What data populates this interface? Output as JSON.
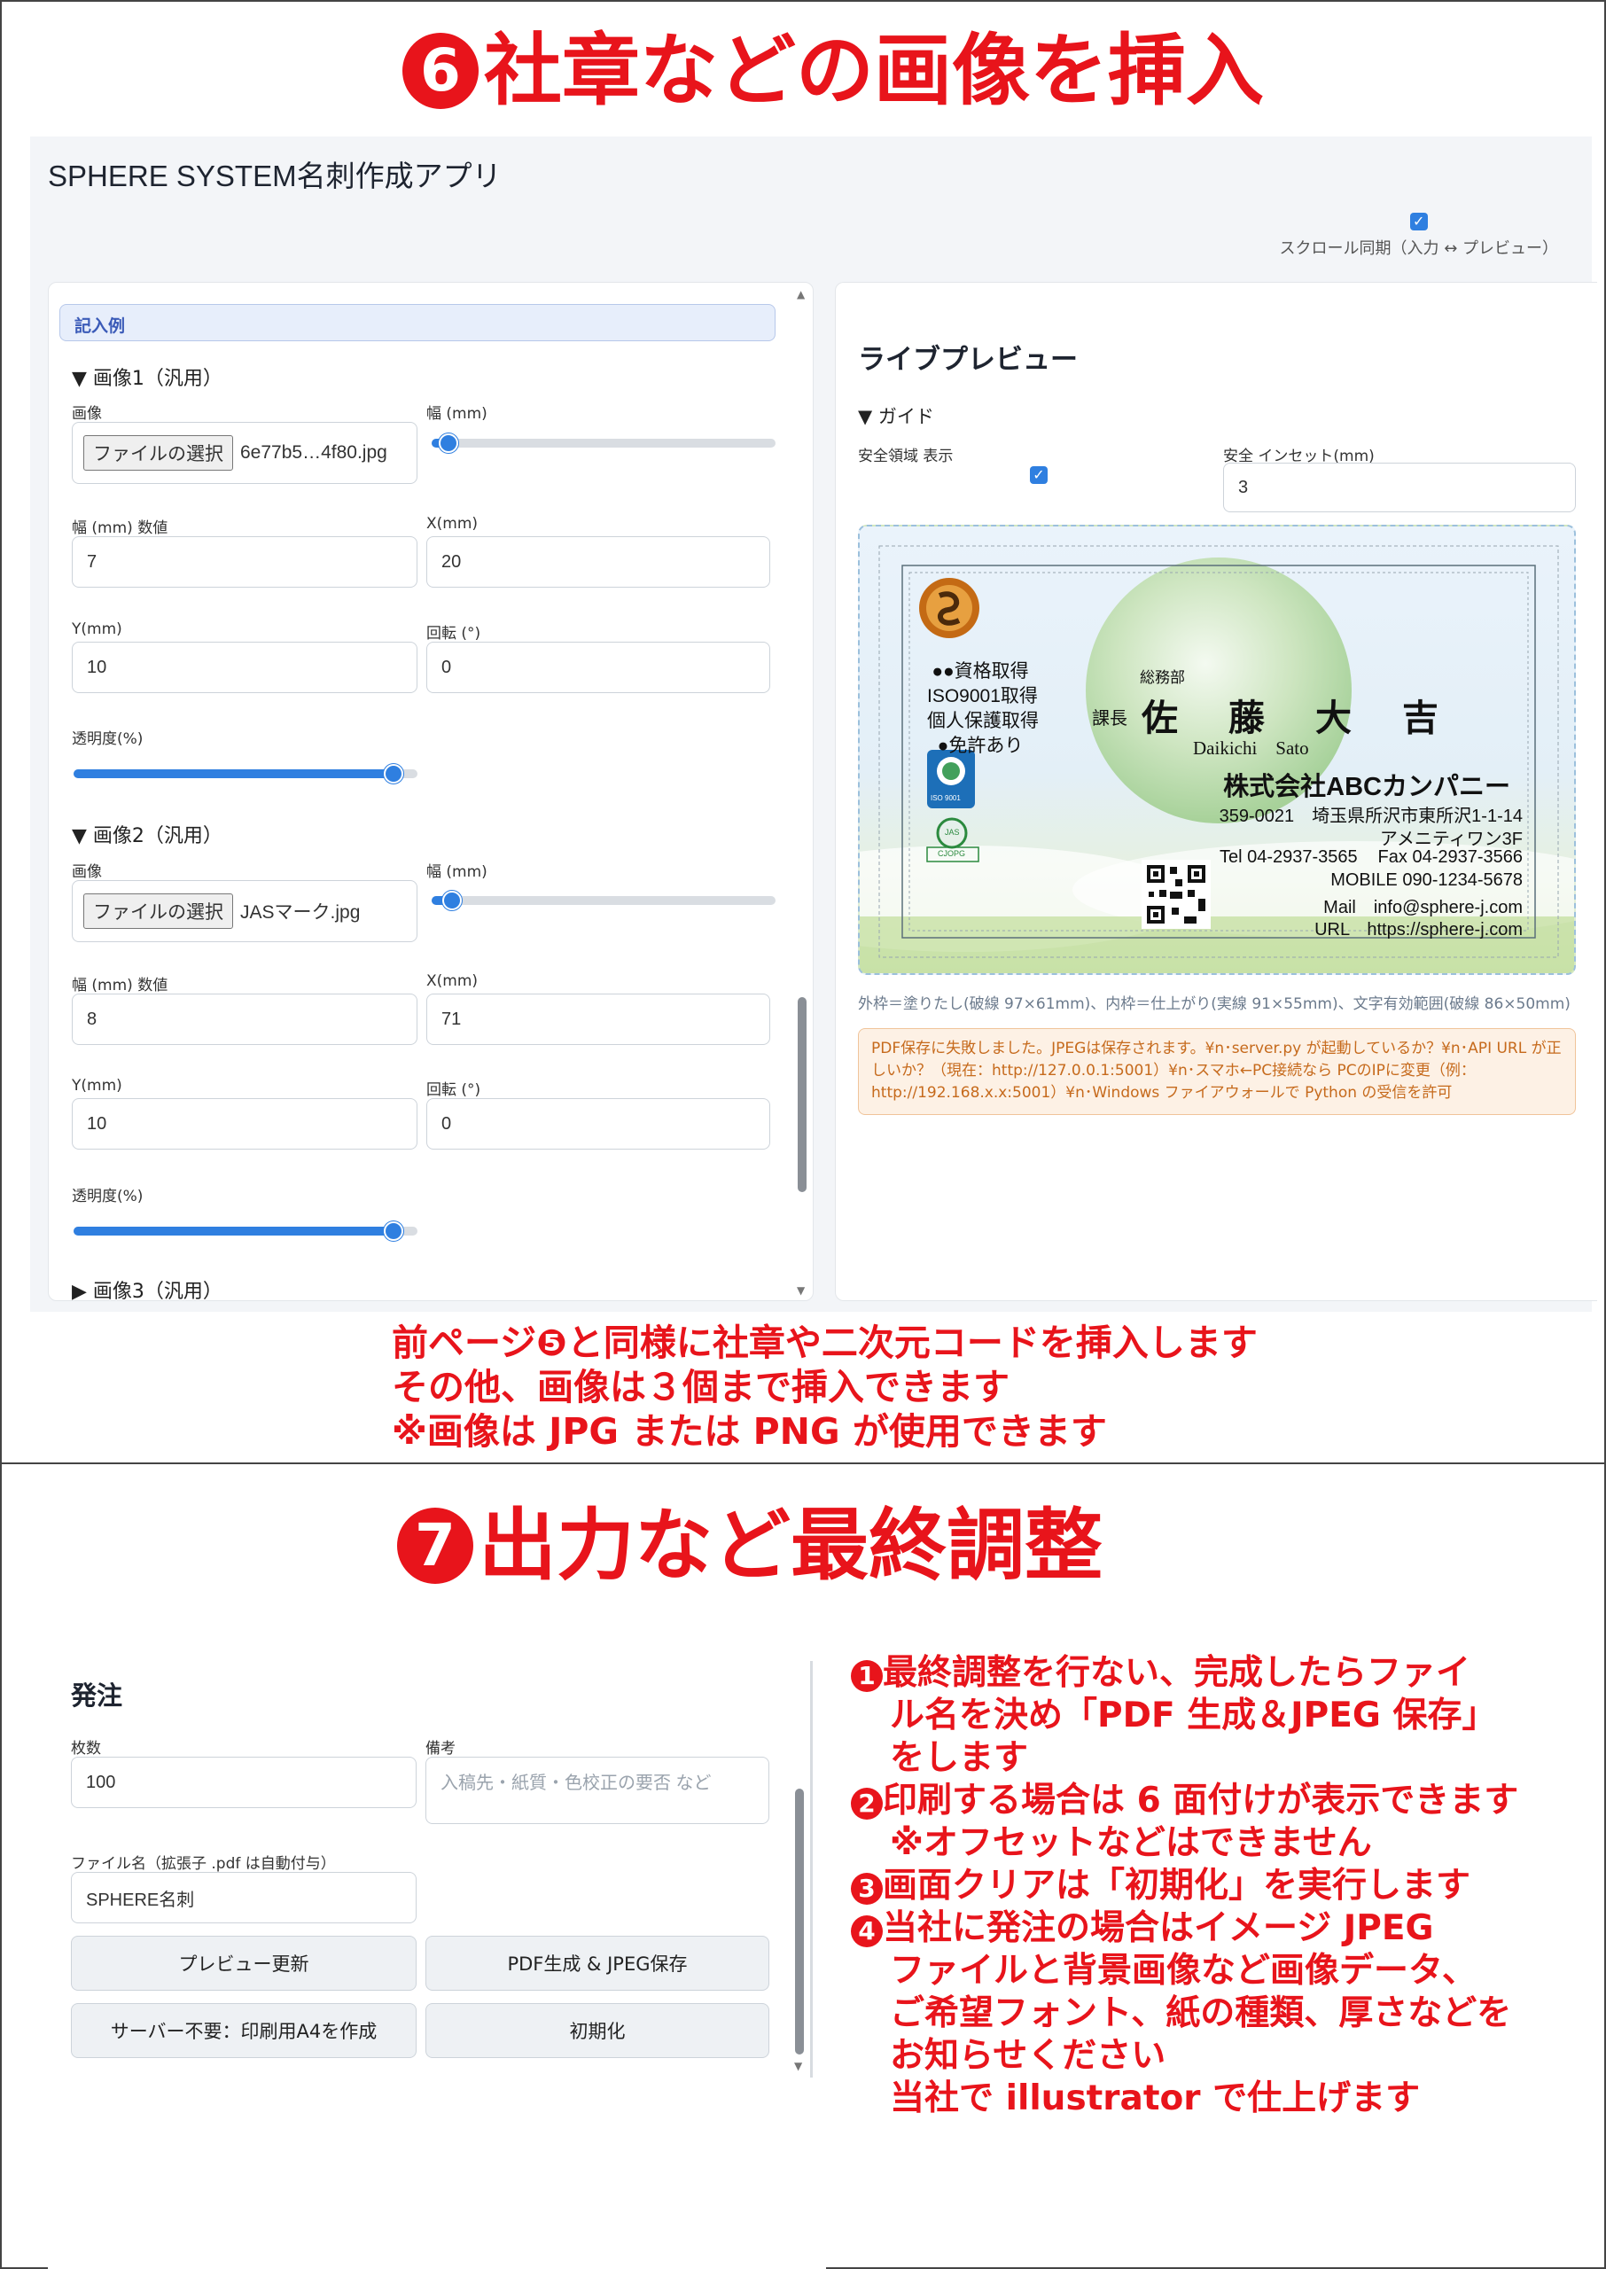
{
  "page1": {
    "step_num": "6",
    "step_title": "社章などの画像を挿入",
    "captions": [
      "前ページ❺と同様に社章や二次元コードを挿入します",
      "その他、画像は３個まで挿入できます",
      "※画像は JPG または PNG が使用できます"
    ]
  },
  "app": {
    "title": "SPHERE SYSTEM名刺作成アプリ",
    "sync_label": "スクロール同期（入力 ↔ プレビュー）",
    "sync_checked": true
  },
  "form": {
    "example_label": "記入例",
    "images": [
      {
        "section": "▼ 画像1（汎用）",
        "image_label": "画像",
        "file_button": "ファイルの選択",
        "file_name": "6e77b5…4f80.jpg",
        "width_label": "幅 (mm)",
        "width_slider": 0.05,
        "width_num_label": "幅 (mm) 数値",
        "width_value": "7",
        "x_label": "X(mm)",
        "x_value": "20",
        "y_label": "Y(mm)",
        "y_value": "10",
        "rot_label": "回転 (°)",
        "rot_value": "0",
        "opacity_label": "透明度(%)",
        "opacity_slider": 0.93
      },
      {
        "section": "▼ 画像2（汎用）",
        "image_label": "画像",
        "file_button": "ファイルの選択",
        "file_name": "JASマーク.jpg",
        "width_label": "幅 (mm)",
        "width_slider": 0.06,
        "width_num_label": "幅 (mm) 数値",
        "width_value": "8",
        "x_label": "X(mm)",
        "x_value": "71",
        "y_label": "Y(mm)",
        "y_value": "10",
        "rot_label": "回転 (°)",
        "rot_value": "0",
        "opacity_label": "透明度(%)",
        "opacity_slider": 0.93
      }
    ],
    "image3_section": "▶ 画像3（汎用）"
  },
  "preview": {
    "title": "ライブプレビュー",
    "guide_label": "▼ ガイド",
    "safe_area_label": "安全領域 表示",
    "safe_area_checked": true,
    "inset_label": "安全 インセット(mm)",
    "inset_value": "3",
    "note": "外枠＝塗りたし(破線 97×61mm)、内枠＝仕上がり(実線 91×55mm)、文字有効範囲(破線 86×50mm)",
    "error": "PDF保存に失敗しました。JPEGは保存されます。¥n･server.py が起動しているか？¥n･API URL が正しいか？（現在：http://127.0.0.1:5001）¥n･スマホ←PC接続なら PCのIPに変更（例：http://192.168.x.x:5001）¥n･Windows ファイアウォールで Python の受信を許可"
  },
  "card": {
    "quals": [
      "●●資格取得",
      "ISO9001取得",
      "個人保護取得",
      "●免許あり"
    ],
    "iso_label": "ISO 9001",
    "jas_label": "JAS",
    "cjopg_label": "CJOPG",
    "department": "総務部",
    "position": "課長",
    "name": "佐　藤　大　吉",
    "romaji": "Daikichi　Sato",
    "company": "株式会社ABCカンパニー",
    "address1": "359-0021　埼玉県所沢市東所沢1-1-14",
    "address2": "アメニティワン3F",
    "tel": "Tel 04-2937-3565",
    "fax": "Fax 04-2937-3566",
    "mobile": "MOBILE 090-1234-5678",
    "mail": "Mail　info@sphere-j.com",
    "url": "URL　https://sphere-j.com"
  },
  "page2": {
    "step_num": "7",
    "step_title": "出力など最終調整",
    "order_title": "発注",
    "qty_label": "枚数",
    "qty_value": "100",
    "notes_label": "備考",
    "notes_placeholder": "入稿先・紙質・色校正の要否 など",
    "filename_label": "ファイル名（拡張子 .pdf は自動付与）",
    "filename_value": "SPHERE名刺",
    "buttons": {
      "preview": "プレビュー更新",
      "pdf": "PDF生成 & JPEG保存",
      "a4": "サーバー不要：印刷用A4を作成",
      "reset": "初期化"
    },
    "instructions": [
      {
        "num": "1",
        "lines": [
          "最終調整を行ない、完成したらファイ",
          "ル名を決め「PDF 生成＆JPEG 保存」",
          "をします"
        ]
      },
      {
        "num": "2",
        "lines": [
          "印刷する場合は 6 面付けが表示できます",
          "※オフセットなどはできません"
        ]
      },
      {
        "num": "3",
        "lines": [
          "画面クリアは「初期化」を実行します"
        ]
      },
      {
        "num": "4",
        "lines": [
          "当社に発注の場合はイメージ JPEG",
          "ファイルと背景画像など画像データ、",
          "ご希望フォント、紙の種類、厚さなどを",
          "お知らせください",
          "当社で illustrator で仕上げます"
        ]
      }
    ]
  },
  "colors": {
    "accent_red": "#e8141b",
    "accent_blue": "#2f7fe0"
  }
}
